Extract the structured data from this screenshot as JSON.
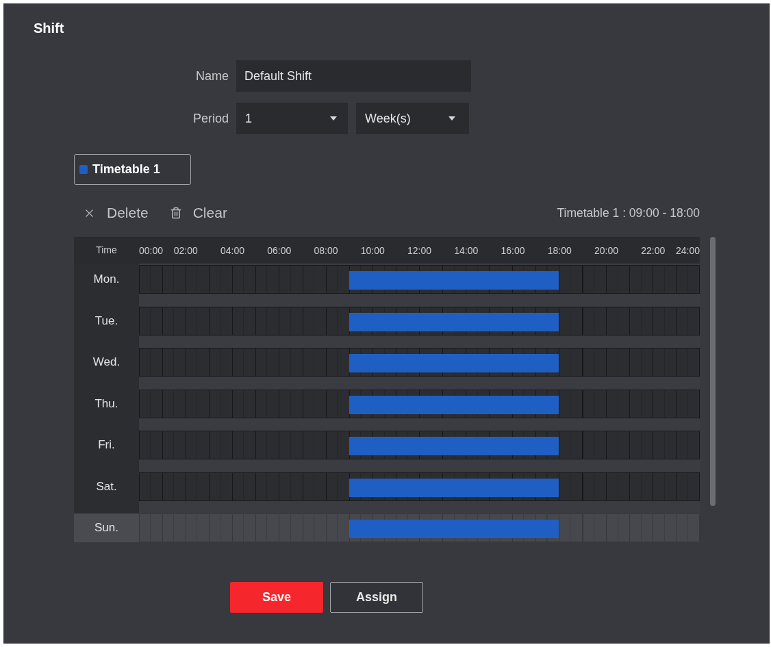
{
  "title": "Shift",
  "form": {
    "name": {
      "label": "Name",
      "value": "Default Shift"
    },
    "period": {
      "label": "Period",
      "count": "1",
      "unit": "Week(s)"
    }
  },
  "timetables": [
    {
      "label": "Timetable 1",
      "color": "#1f5fc4",
      "selected": true
    }
  ],
  "toolbar": {
    "actions": [
      {
        "kind": "delete",
        "label": "Delete"
      },
      {
        "kind": "clear",
        "label": "Clear"
      }
    ],
    "summary": "Timetable 1 : 09:00 - 18:00"
  },
  "schedule": {
    "header": "Time",
    "ticks": [
      "00:00",
      "02:00",
      "04:00",
      "06:00",
      "08:00",
      "10:00",
      "12:00",
      "14:00",
      "16:00",
      "18:00",
      "20:00",
      "22:00",
      "24:00"
    ],
    "days": [
      {
        "label": "Mon.",
        "selected": false,
        "hour_slots": [
          false,
          false,
          false,
          false,
          false,
          false,
          false,
          false,
          false,
          true,
          true,
          true,
          true,
          true,
          true,
          true,
          true,
          true,
          false,
          false,
          false,
          false,
          false,
          false
        ]
      },
      {
        "label": "Tue.",
        "selected": false,
        "hour_slots": [
          false,
          false,
          false,
          false,
          false,
          false,
          false,
          false,
          false,
          true,
          true,
          true,
          true,
          true,
          true,
          true,
          true,
          true,
          false,
          false,
          false,
          false,
          false,
          false
        ]
      },
      {
        "label": "Wed.",
        "selected": false,
        "hour_slots": [
          false,
          false,
          false,
          false,
          false,
          false,
          false,
          false,
          false,
          true,
          true,
          true,
          true,
          true,
          true,
          true,
          true,
          true,
          false,
          false,
          false,
          false,
          false,
          false
        ]
      },
      {
        "label": "Thu.",
        "selected": false,
        "hour_slots": [
          false,
          false,
          false,
          false,
          false,
          false,
          false,
          false,
          false,
          true,
          true,
          true,
          true,
          true,
          true,
          true,
          true,
          true,
          false,
          false,
          false,
          false,
          false,
          false
        ]
      },
      {
        "label": "Fri.",
        "selected": false,
        "hour_slots": [
          false,
          false,
          false,
          false,
          false,
          false,
          false,
          false,
          false,
          true,
          true,
          true,
          true,
          true,
          true,
          true,
          true,
          true,
          false,
          false,
          false,
          false,
          false,
          false
        ]
      },
      {
        "label": "Sat.",
        "selected": false,
        "hour_slots": [
          false,
          false,
          false,
          false,
          false,
          false,
          false,
          false,
          false,
          true,
          true,
          true,
          true,
          true,
          true,
          true,
          true,
          true,
          false,
          false,
          false,
          false,
          false,
          false
        ]
      },
      {
        "label": "Sun.",
        "selected": true,
        "hour_slots": [
          false,
          false,
          false,
          false,
          false,
          false,
          false,
          false,
          false,
          true,
          true,
          true,
          true,
          true,
          true,
          true,
          true,
          true,
          false,
          false,
          false,
          false,
          false,
          false
        ]
      }
    ]
  },
  "buttons": [
    {
      "kind": "primary",
      "label": "Save"
    },
    {
      "kind": "secondary",
      "label": "Assign"
    }
  ]
}
